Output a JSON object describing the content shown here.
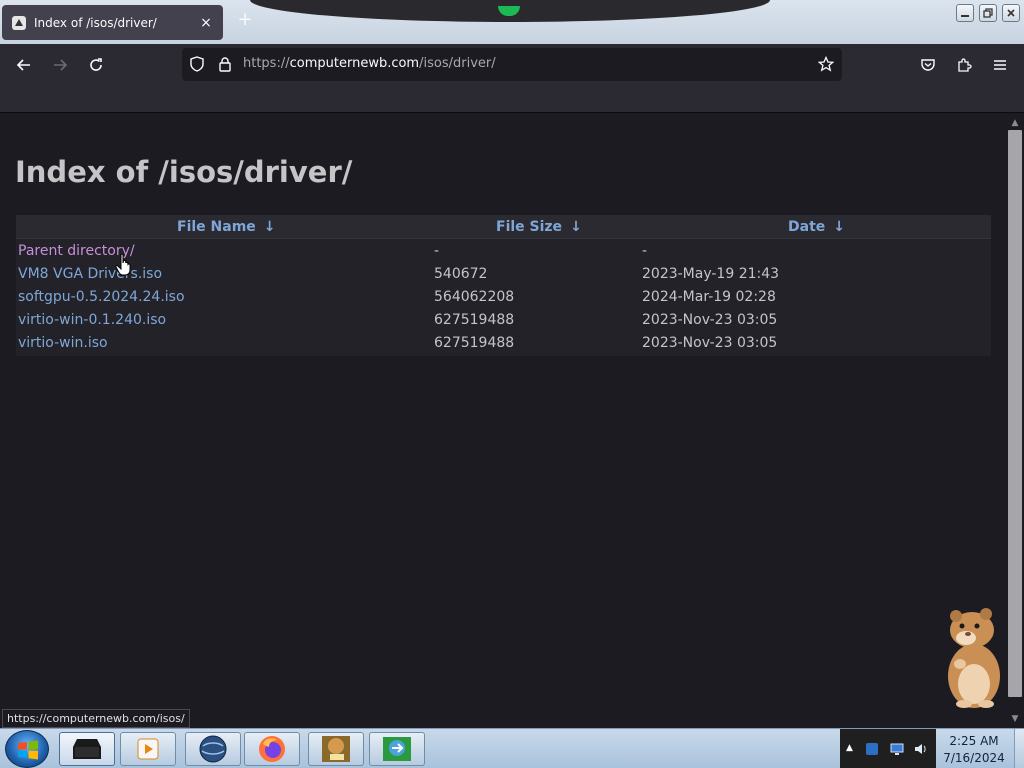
{
  "browser": {
    "tab_title": "Index of /isos/driver/",
    "new_tab_symbol": "+",
    "close_symbol": "×",
    "url_scheme": "https://",
    "url_host": "computernewb.com",
    "url_path": "/isos/driver/"
  },
  "page": {
    "heading": "Index of /isos/driver/",
    "columns": {
      "name": "File Name",
      "size": "File Size",
      "date": "Date",
      "sort_arrow": "↓"
    },
    "rows": [
      {
        "name": "Parent directory/",
        "size": "-",
        "date": "-",
        "visited": true
      },
      {
        "name": "VM8 VGA Drivers.iso",
        "size": "540672",
        "date": "2023-May-19 21:43",
        "visited": false
      },
      {
        "name": "softgpu-0.5.2024.24.iso",
        "size": "564062208",
        "date": "2024-Mar-19 02:28",
        "visited": false
      },
      {
        "name": "virtio-win-0.1.240.iso",
        "size": "627519488",
        "date": "2023-Nov-23 03:05",
        "visited": false
      },
      {
        "name": "virtio-win.iso",
        "size": "627519488",
        "date": "2023-Nov-23 03:05",
        "visited": false
      }
    ]
  },
  "status_bar": {
    "link_url": "https://computernewb.com/isos/"
  },
  "taskbar": {
    "time": "2:25 AM",
    "date": "7/16/2024",
    "apps": [
      "terminal-icon",
      "media-player-icon",
      "browser-globe-icon",
      "firefox-icon",
      "bonzi-box-icon",
      "download-manager-icon"
    ]
  },
  "colors": {
    "link": "#7ea7d8",
    "visited_link": "#c58fd9",
    "text": "#c5c5c8",
    "page_bg": "#1c1b22",
    "toolbar_bg": "#2b2a33"
  }
}
